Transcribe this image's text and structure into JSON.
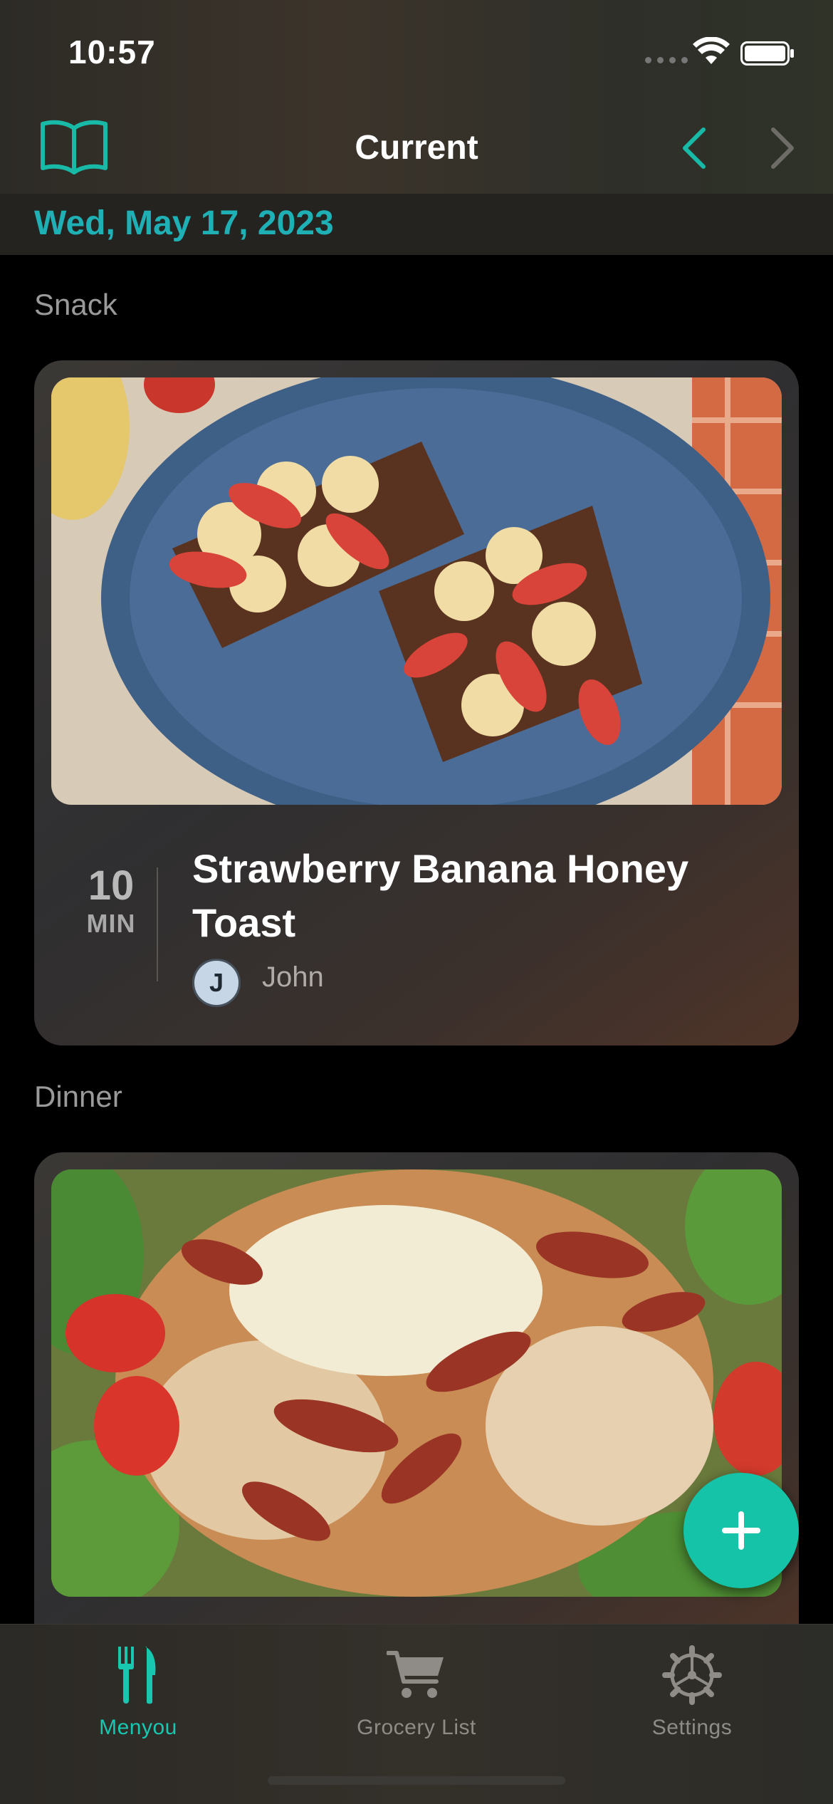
{
  "status_bar": {
    "time": "10:57"
  },
  "header": {
    "title": "Current",
    "left_icon": "book-icon",
    "prev_icon": "chevron-left-icon",
    "next_icon": "chevron-right-icon"
  },
  "date": "Wed, May 17, 2023",
  "meals": [
    {
      "section": "Snack",
      "time_value": "10",
      "time_unit": "MIN",
      "title": "Strawberry Banana Honey Toast",
      "owner_initial": "J",
      "owner_name": "John"
    },
    {
      "section": "Dinner"
    }
  ],
  "fab": {
    "icon": "plus-icon"
  },
  "tabbar": {
    "tabs": [
      {
        "label": "Menyou",
        "icon": "fork-knife-icon",
        "active": true
      },
      {
        "label": "Grocery List",
        "icon": "cart-icon",
        "active": false
      },
      {
        "label": "Settings",
        "icon": "gear-icon",
        "active": false
      }
    ]
  },
  "colors": {
    "accent": "#1fb0b6",
    "fab": "#15c3a8",
    "active_tab": "#18c7b0",
    "inactive_tab": "#8f8c87"
  }
}
